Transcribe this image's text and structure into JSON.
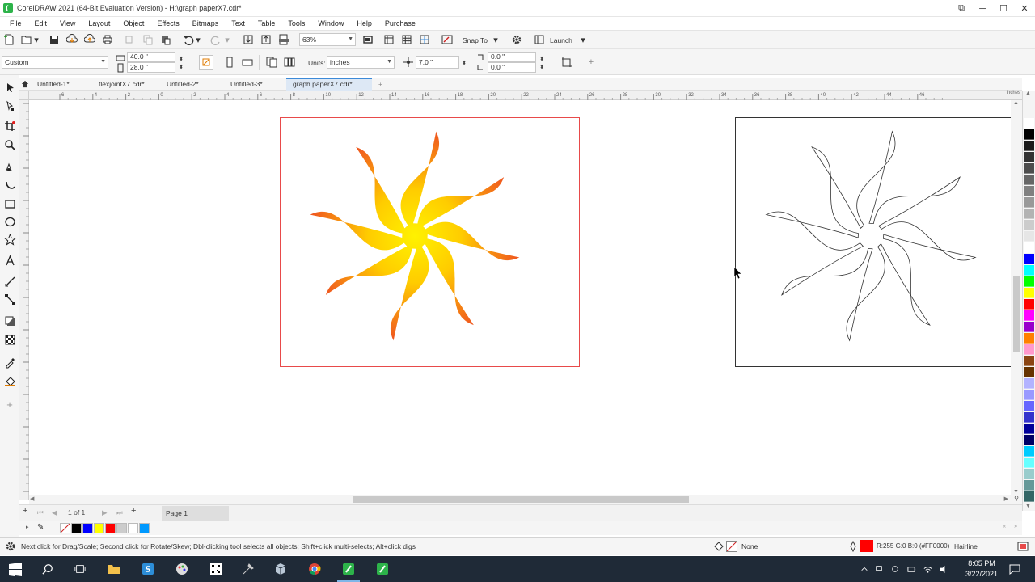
{
  "window": {
    "title": "CorelDRAW 2021 (64-Bit Evaluation Version) - H:\\graph paperX7.cdr*",
    "controls": [
      "⧉",
      "─",
      "☐",
      "✕"
    ]
  },
  "menu": [
    "File",
    "Edit",
    "View",
    "Layout",
    "Object",
    "Effects",
    "Bitmaps",
    "Text",
    "Table",
    "Tools",
    "Window",
    "Help",
    "Purchase"
  ],
  "toolbar": {
    "zoom_value": "63%",
    "snap_label": "Snap To",
    "launch_label": "Launch"
  },
  "property_bar": {
    "page_preset": "Custom",
    "width": "40.0 \"",
    "height": "28.0 \"",
    "units_label": "Units:",
    "units_value": "inches",
    "nudge": "7.0 \"",
    "dup_x": "0.0 \"",
    "dup_y": "0.0 \""
  },
  "doc_tabs": [
    {
      "label": "Untitled-1*",
      "active": false
    },
    {
      "label": "flexjointX7.cdr*",
      "active": false
    },
    {
      "label": "Untitled-2*",
      "active": false
    },
    {
      "label": "Untitled-3*",
      "active": false
    },
    {
      "label": "graph paperX7.cdr*",
      "active": true
    }
  ],
  "ruler": {
    "top_labels": [
      "6",
      "4",
      "2",
      "0",
      "2",
      "4",
      "6",
      "8",
      "10",
      "12",
      "14",
      "16",
      "18",
      "20",
      "22",
      "24",
      "26",
      "28",
      "30",
      "32",
      "34",
      "36",
      "38",
      "40",
      "42",
      "44",
      "46"
    ],
    "units": "inches"
  },
  "page_nav": {
    "page_of": "1 of 1",
    "page_tab": "Page 1"
  },
  "status": {
    "hint": "Next click for Drag/Scale; Second click for Rotate/Skew; Dbl-clicking tool selects all objects; Shift+click multi-selects; Alt+click digs",
    "fill_label": "None",
    "outline_color_text": "R:255 G:0 B:0 (#FF0000)",
    "outline_width": "Hairline"
  },
  "taskbar": {
    "time": "8:05 PM",
    "date": "3/22/2021"
  },
  "colors": {
    "accent": "#3c8ad8",
    "outline_red": "#ff0000",
    "gradient_inner": "#fff200",
    "gradient_outer": "#f05a1e"
  },
  "palette": [
    "#ffffff",
    "#000000",
    "#1a1a1a",
    "#333333",
    "#4d4d4d",
    "#666666",
    "#808080",
    "#999999",
    "#b3b3b3",
    "#cccccc",
    "#e6e6e6",
    "#ffffff",
    "#0000ff",
    "#00ffff",
    "#00ff00",
    "#ffff00",
    "#ff0000",
    "#ff00ff",
    "#9900cc",
    "#ff8000",
    "#ff99cc",
    "#8b4513",
    "#663300",
    "#b3b3ff",
    "#9999ff",
    "#6666ff",
    "#3333cc",
    "#000099",
    "#000066",
    "#00ccff",
    "#66ffff",
    "#99cccc",
    "#669999",
    "#336666"
  ],
  "doc_palette": [
    "#000000",
    "#0000ff",
    "#ffff00",
    "#ff0000",
    "#cccccc",
    "#ffffff",
    "#0099ff"
  ]
}
